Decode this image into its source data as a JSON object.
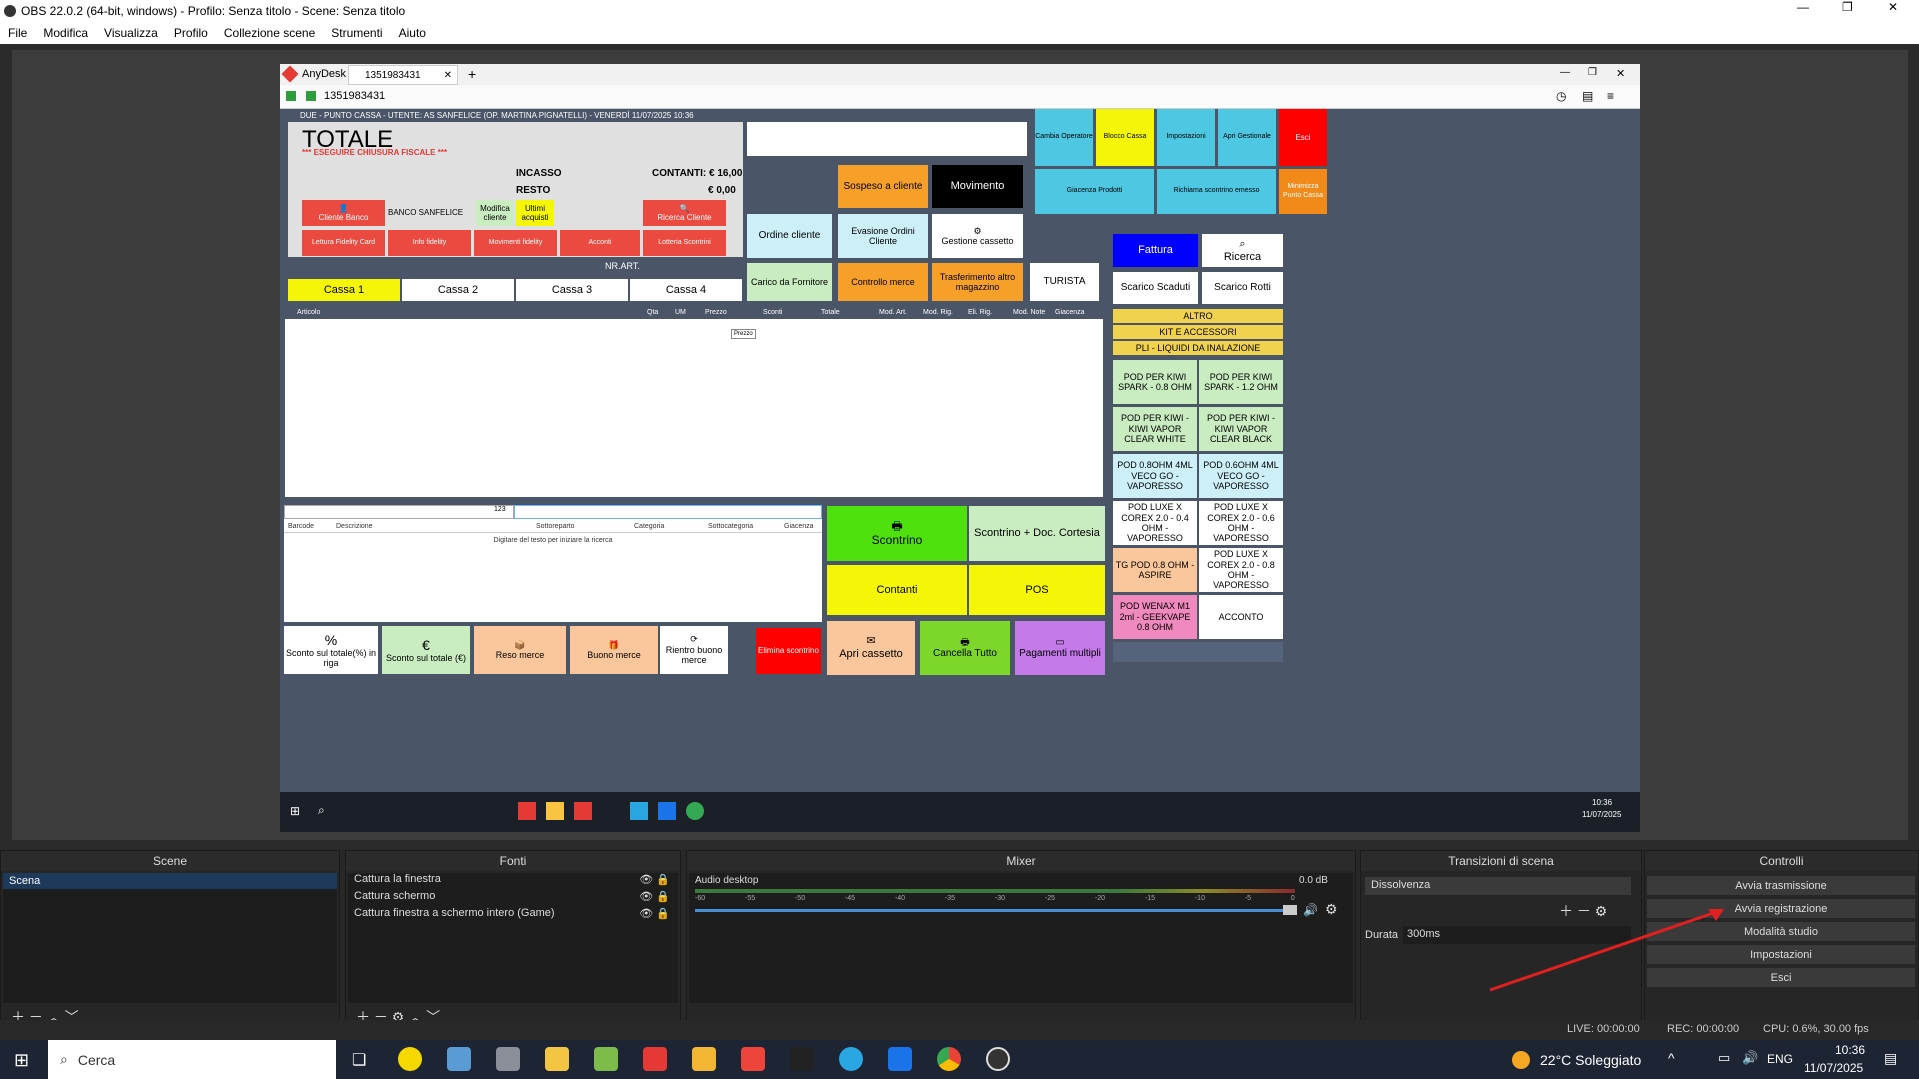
{
  "obs": {
    "title": "OBS 22.0.2 (64-bit, windows) - Profilo: Senza titolo - Scene: Senza titolo",
    "menu": [
      "File",
      "Modifica",
      "Visualizza",
      "Profilo",
      "Collezione scene",
      "Strumenti",
      "Aiuto"
    ],
    "scene_label": "Scene",
    "scene_item": "Scena",
    "fonti_label": "Fonti",
    "sources": [
      "Cattura la finestra",
      "Cattura schermo",
      "Cattura finestra a schermo intero (Game)"
    ],
    "mixer_label": "Mixer",
    "mixer_track": "Audio desktop",
    "mixer_db": "0.0 dB",
    "mixer_ticks": [
      "-60",
      "-55",
      "-50",
      "-45",
      "-40",
      "-35",
      "-30",
      "-25",
      "-20",
      "-15",
      "-10",
      "-5",
      "0"
    ],
    "transitions_label": "Transizioni di scena",
    "transition": "Dissolvenza",
    "duration_label": "Durata",
    "duration": "300ms",
    "controls_label": "Controlli",
    "controls": [
      "Avvia trasmissione",
      "Avvia registrazione",
      "Modalità studio",
      "Impostazioni",
      "Esci"
    ],
    "status": {
      "live": "LIVE: 00:00:00",
      "rec": "REC: 00:00:00",
      "cpu": "CPU: 0.6%, 30.00 fps"
    }
  },
  "anydesk": {
    "app": "AnyDesk",
    "tab_id": "1351983431",
    "address": "1351983431",
    "time": "10:36",
    "date": "11/07/2025"
  },
  "pos": {
    "header": "DUE - PUNTO CASSA - UTENTE: AS SANFELICE (OP. MARTINA PIGNATELLI) - VENERDÌ 11/07/2025 10:36",
    "totale": "TOTALE",
    "warning": "*** ESEGUIRE CHIUSURA FISCALE ***",
    "incasso": "INCASSO",
    "resto": "RESTO",
    "contanti": "CONTANTI: € 16,00",
    "resto_val": "€ 0,00",
    "cliente_banco": "Cliente Banco",
    "banco_name": "BANCO SANFELICE",
    "modifica_cliente": "Modifica cliente",
    "ultimi_acquisti": "Ultimi acquisti",
    "ricerca_cliente": "Ricerca Cliente",
    "lettura_fidelity": "Lettura Fidelity Card",
    "info_fidelity": "Info fidelity",
    "movimenti_fidelity": "Movimenti fidelity",
    "acconti": "Acconti",
    "lotteria": "Lotteria Scontrini",
    "nr_art": "NR.ART.",
    "casse": [
      "Cassa 1",
      "Cassa 2",
      "Cassa 3",
      "Cassa 4"
    ],
    "top_buttons": {
      "sospeso": "Sospeso a cliente",
      "movimento": "Movimento",
      "ordine": "Ordine cliente",
      "evasione": "Evasione Ordini Cliente",
      "gestione": "Gestione cassetto",
      "carico": "Carico da Fornitore",
      "controllo": "Controllo merce",
      "trasferimento": "Trasferimento altro magazzino",
      "turista": "TURISTA"
    },
    "icons": {
      "cambia": "Cambia Operatore",
      "blocco": "Blocco Cassa",
      "impostazioni": "Impostazioni",
      "apri_gestionale": "Apri Gestionale",
      "esci": "Esci",
      "giacenza": "Giacenza Prodotti",
      "richiama": "Richiama scontrino emesso",
      "minimizza": "Minimizza Punto Cassa"
    },
    "fattura": "Fattura",
    "ricerca": "Ricerca",
    "scarico_scaduti": "Scarico Scaduti",
    "scarico_rotti": "Scarico Rotti",
    "categories": [
      "ALTRO",
      "KIT E ACCESSORI",
      "PLI - LIQUIDI DA INALAZIONE"
    ],
    "products": [
      "POD PER KIWI SPARK - 0.8 OHM",
      "POD PER KIWI SPARK - 1.2 OHM",
      "POD PER KIWI - KIWI VAPOR CLEAR WHITE",
      "POD PER KIWI - KIWI VAPOR CLEAR BLACK",
      "POD 0.8OHM 4ML VECO GO - VAPORESSO",
      "POD 0.6OHM 4ML VECO GO - VAPORESSO",
      "POD LUXE X COREX 2.0 - 0.4 OHM - VAPORESSO",
      "POD LUXE X COREX 2.0 - 0.6 OHM - VAPORESSO",
      "TG POD 0.8 OHM - ASPIRE",
      "POD LUXE X COREX 2.0 - 0.8 OHM - VAPORESSO",
      "POD WENAX M1 2ml - GEEKVAPE 0.8 OHM",
      "ACCONTO"
    ],
    "grid_cols": [
      "Articolo",
      "Qta",
      "UM",
      "Prezzo",
      "Sconti",
      "Totale",
      "Mod. Art.",
      "Mod. Rig.",
      "Eli. Rig.",
      "Mod. Note",
      "Giacenza"
    ],
    "tooltip": "Prezzo",
    "barcode_icon": "123",
    "search_cols": [
      "Barcode",
      "Descrizione",
      "Sottoreparto",
      "Categoria",
      "Sottocategoria",
      "Giacenza"
    ],
    "search_hint": "Digitare del testo per iniziare la ricerca",
    "scontrino": "Scontrino",
    "scontrino_cortesia": "Scontrino + Doc. Cortesia",
    "contanti_btn": "Contanti",
    "pos_btn": "POS",
    "bottom": {
      "sconto_pct": "Sconto sul totale(%) in riga",
      "sconto_eur": "Sconto sul totale (€)",
      "reso": "Reso merce",
      "buono": "Buono merce",
      "rientro": "Rientro buono merce",
      "elimina": "Elimina scontrino",
      "apri": "Apri cassetto",
      "cancella": "Cancella Tutto",
      "pagamenti": "Pagamenti multipli"
    }
  },
  "win": {
    "search": "Cerca",
    "weather": "22°C  Soleggiato",
    "lang": "ENG",
    "time": "10:36",
    "date": "11/07/2025"
  },
  "colors": {
    "annotation_arrow": "#e02020",
    "pos_bg": "#4a5568"
  }
}
